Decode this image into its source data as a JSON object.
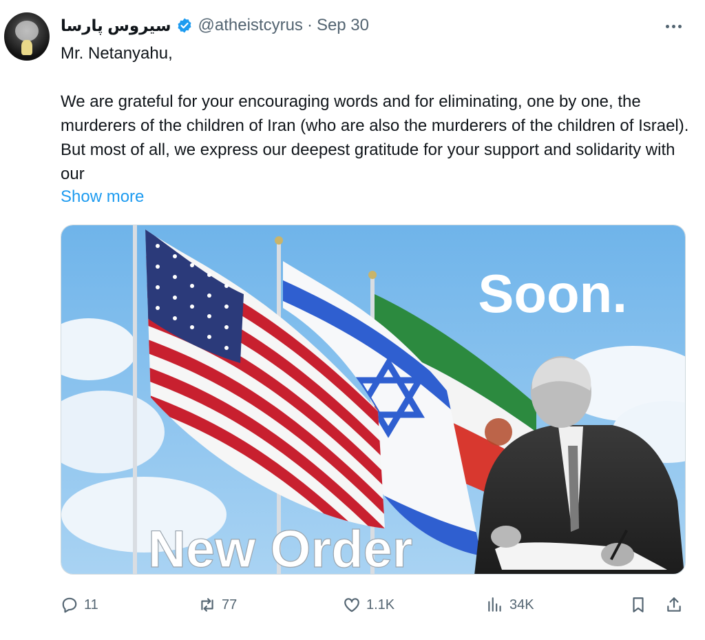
{
  "tweet": {
    "display_name": "سیروس پارسا",
    "handle": "@atheistcyrus",
    "separator": "·",
    "date": "Sep 30",
    "greeting": "Mr. Netanyahu,",
    "body": "We are grateful for your encouraging words and for eliminating, one by one, the murderers of the children of Iran (who are also the murderers of the children of Israel). But most of all, we express our deepest gratitude for your support and solidarity with our",
    "show_more": "Show more"
  },
  "media": {
    "overlay_top": "Soon.",
    "overlay_bottom": "New Order"
  },
  "actions": {
    "replies": "11",
    "reposts": "77",
    "likes": "1.1K",
    "views": "34K"
  },
  "colors": {
    "accent": "#1d9bf0",
    "muted": "#536471",
    "text": "#0f1419",
    "verified": "#1d9bf0"
  },
  "icons": {
    "verified": "verified-badge-icon",
    "more": "more-icon",
    "reply": "reply-icon",
    "repost": "repost-icon",
    "like": "heart-icon",
    "views": "views-icon",
    "bookmark": "bookmark-icon",
    "share": "share-icon"
  }
}
